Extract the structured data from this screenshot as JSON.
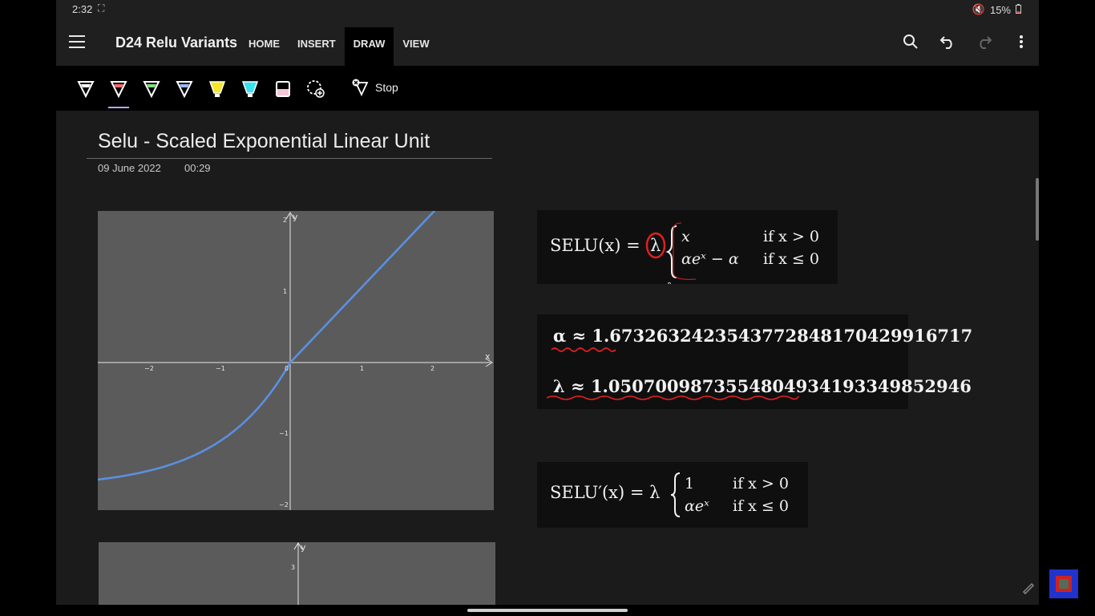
{
  "status": {
    "time": "2:32",
    "battery": "15%"
  },
  "app": {
    "notebook_title": "D24 Relu Variants",
    "tabs": [
      "HOME",
      "INSERT",
      "DRAW",
      "VIEW"
    ],
    "active_tab": "DRAW",
    "actions": [
      "search-icon",
      "undo-icon",
      "redo-icon",
      "more-vert-icon"
    ]
  },
  "ribbon": {
    "pens": [
      {
        "name": "pen-white",
        "color": "#ffffff"
      },
      {
        "name": "pen-red",
        "color": "#ff6b6b"
      },
      {
        "name": "pen-green",
        "color": "#7ee07e"
      },
      {
        "name": "pen-blue",
        "color": "#9ab8ff"
      },
      {
        "name": "highlighter-yellow",
        "color": "#f5e62a"
      },
      {
        "name": "highlighter-cyan",
        "color": "#38e0f0"
      },
      {
        "name": "highlighter-pink",
        "color": "#f4c6d8"
      }
    ],
    "selected_pen": "pen-red",
    "stop_label": "Stop"
  },
  "page": {
    "title": "Selu - Scaled Exponential Linear Unit",
    "date": "09 June 2022",
    "time": "00:29"
  },
  "graph1": {
    "x_label": "x",
    "y_label": "y",
    "x_ticks": [
      "−2",
      "−1",
      "0",
      "1",
      "2"
    ],
    "y_ticks": [
      "2",
      "1",
      "−1",
      "−2"
    ],
    "curve_color": "#5b8fe0"
  },
  "graph2": {
    "y_label": "y",
    "y_ticks": [
      "3"
    ]
  },
  "formula1": {
    "lhs": "SELU(x) =",
    "lambda": "λ",
    "case1_expr": "x",
    "case1_cond": "if x > 0",
    "case2_expr": "αeˣ − α",
    "case2_cond": "if x ≤ 0"
  },
  "constants": {
    "alpha": "α ≈ 1.6732632423543772848170429916717",
    "lambda": "λ ≈ 1.0507009873554804934193349852946"
  },
  "formula2": {
    "lhs": "SELU′(x) = λ",
    "case1_expr": "1",
    "case1_cond": "if x > 0",
    "case2_expr": "αeˣ",
    "case2_cond": "if x ≤ 0"
  },
  "annotation_color": "#e02020"
}
